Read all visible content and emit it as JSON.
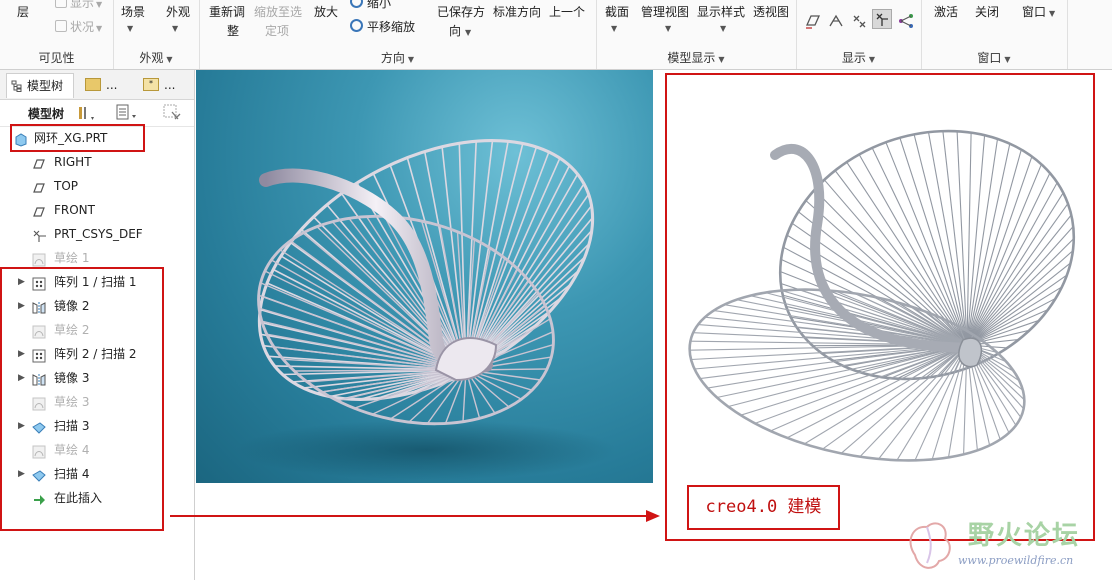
{
  "ribbon": {
    "visibility_group": {
      "label": "可见性",
      "layer": "层",
      "show": "显示",
      "status": "状况"
    },
    "appearance_group": {
      "label": "外观",
      "scene": "场景",
      "appearance": "外观"
    },
    "orientation_group": {
      "label": "方向",
      "refit_1": "重新调",
      "refit_2": "整",
      "zoom_to_selected_1": "缩放至选",
      "zoom_to_selected_2": "定项",
      "zoom_in": "放大",
      "zoom_out": "缩小",
      "pan_zoom": "平移缩放",
      "saved_orientations_1": "已保存方",
      "saved_orientations_2": "向",
      "standard_orientation": "标准方向",
      "previous": "上一个"
    },
    "model_display_group": {
      "label": "模型显示",
      "section": "截面",
      "manage_views": "管理视图",
      "display_style": "显示样式",
      "perspective": "透视图"
    },
    "display_group": {
      "label": "显示"
    },
    "window_group": {
      "label": "窗口",
      "activate": "激活",
      "close": "关闭",
      "windows": "窗口"
    }
  },
  "panel": {
    "tabs": [
      "模型树",
      "...",
      "..."
    ],
    "toolbar_label": "模型树",
    "tree": [
      {
        "label": "网环_XG.PRT",
        "type": "part",
        "expandable": false,
        "dim": false
      },
      {
        "label": "RIGHT",
        "type": "plane",
        "expandable": false,
        "dim": false
      },
      {
        "label": "TOP",
        "type": "plane",
        "expandable": false,
        "dim": false
      },
      {
        "label": "FRONT",
        "type": "plane",
        "expandable": false,
        "dim": false
      },
      {
        "label": "PRT_CSYS_DEF",
        "type": "csys",
        "expandable": false,
        "dim": false
      },
      {
        "label": "草绘 1",
        "type": "sketch",
        "expandable": false,
        "dim": true
      },
      {
        "label": "阵列 1 / 扫描 1",
        "type": "pattern",
        "expandable": true,
        "dim": false
      },
      {
        "label": "镜像 2",
        "type": "mirror",
        "expandable": true,
        "dim": false
      },
      {
        "label": "草绘 2",
        "type": "sketch",
        "expandable": false,
        "dim": true
      },
      {
        "label": "阵列 2 / 扫描 2",
        "type": "pattern",
        "expandable": true,
        "dim": false
      },
      {
        "label": "镜像 3",
        "type": "mirror",
        "expandable": true,
        "dim": false
      },
      {
        "label": "草绘 3",
        "type": "sketch",
        "expandable": false,
        "dim": true
      },
      {
        "label": "扫描 3",
        "type": "sweep",
        "expandable": true,
        "dim": false
      },
      {
        "label": "草绘 4",
        "type": "sketch",
        "expandable": false,
        "dim": true
      },
      {
        "label": "扫描 4",
        "type": "sweep",
        "expandable": true,
        "dim": false
      },
      {
        "label": "在此插入",
        "type": "insert",
        "expandable": false,
        "dim": false
      }
    ]
  },
  "caption": "creo4.0  建模",
  "watermark": {
    "title": "野火论坛",
    "url": "www.proewildfire.cn"
  },
  "colors": {
    "annotation_red": "#d01414",
    "photo_bg": "#2f87a5",
    "wire": "#8f949c",
    "watermark_green": "#a8d3a5"
  }
}
